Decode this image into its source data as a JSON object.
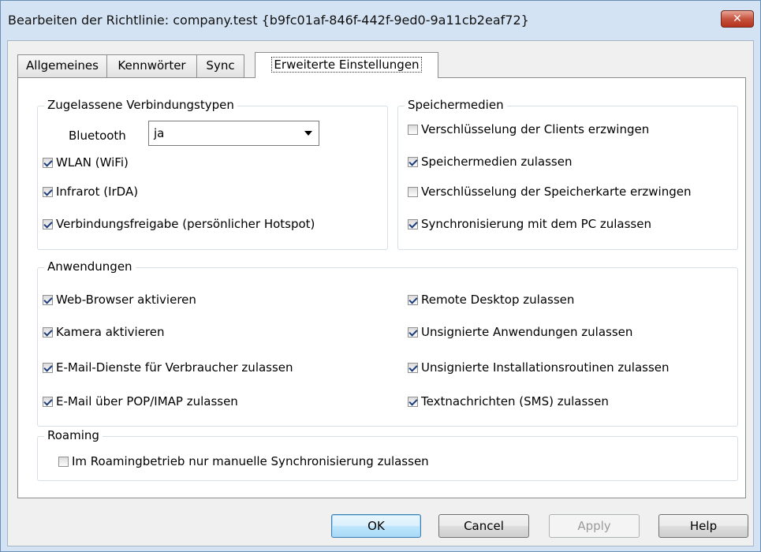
{
  "window": {
    "title": "Bearbeiten der Richtlinie:  company.test {b9fc01af-846f-442f-9ed0-9a11cb2eaf72}",
    "close_glyph": "✕"
  },
  "tabs": [
    {
      "label": "Allgemeines",
      "active": false
    },
    {
      "label": "Kennwörter",
      "active": false
    },
    {
      "label": "Sync",
      "active": false
    },
    {
      "label": "Erweiterte Einstellungen",
      "active": true
    }
  ],
  "connections": {
    "legend": "Zugelassene Verbindungstypen",
    "bluetooth_label": "Bluetooth",
    "bluetooth_value": "ja",
    "items": [
      {
        "label": "WLAN (WiFi)",
        "checked": true
      },
      {
        "label": "Infrarot (IrDA)",
        "checked": true
      },
      {
        "label": "Verbindungsfreigabe (persönlicher Hotspot)",
        "checked": true
      }
    ]
  },
  "storage": {
    "legend": "Speichermedien",
    "items": [
      {
        "label": "Verschlüsselung der Clients erzwingen",
        "checked": false
      },
      {
        "label": "Speichermedien zulassen",
        "checked": true
      },
      {
        "label": "Verschlüsselung der Speicherkarte erzwingen",
        "checked": false
      },
      {
        "label": "Synchronisierung mit dem PC zulassen",
        "checked": true
      }
    ]
  },
  "apps": {
    "legend": "Anwendungen",
    "left": [
      {
        "label": "Web-Browser aktivieren",
        "checked": true
      },
      {
        "label": "Kamera aktivieren",
        "checked": true
      },
      {
        "label": "E-Mail-Dienste für Verbraucher zulassen",
        "checked": true
      },
      {
        "label": "E-Mail über POP/IMAP zulassen",
        "checked": true
      }
    ],
    "right": [
      {
        "label": "Remote Desktop zulassen",
        "checked": true
      },
      {
        "label": "Unsignierte Anwendungen zulassen",
        "checked": true
      },
      {
        "label": "Unsignierte Installationsroutinen zulassen",
        "checked": true
      },
      {
        "label": "Textnachrichten (SMS) zulassen",
        "checked": true
      }
    ]
  },
  "roaming": {
    "legend": "Roaming",
    "items": [
      {
        "label": "Im Roamingbetrieb nur manuelle Synchronisierung zulassen",
        "checked": false
      }
    ]
  },
  "buttons": {
    "ok": "OK",
    "cancel": "Cancel",
    "apply": "Apply",
    "help": "Help"
  }
}
